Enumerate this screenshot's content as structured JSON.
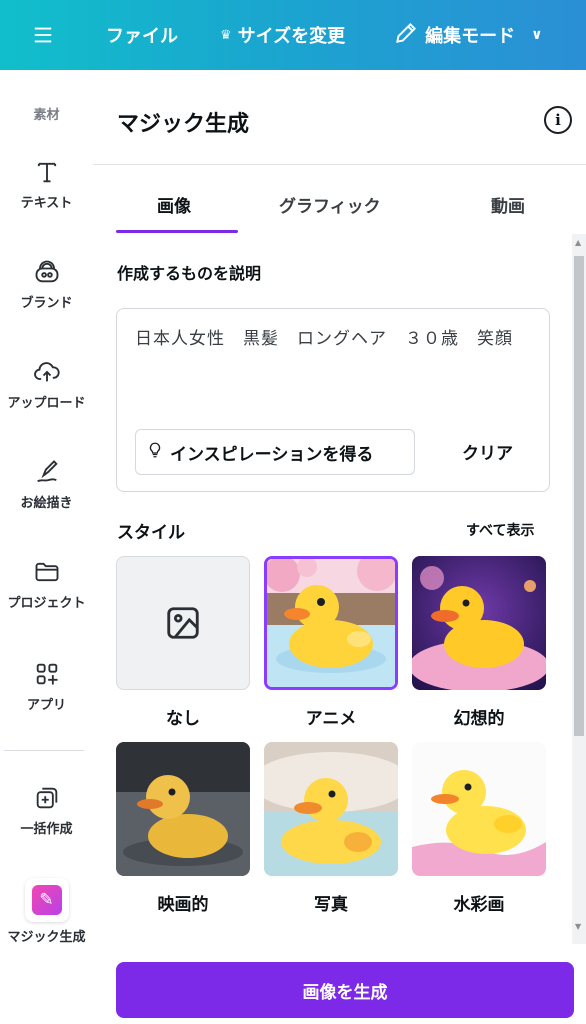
{
  "topbar": {
    "file": "ファイル",
    "resize": "サイズを変更",
    "edit_mode": "編集モード"
  },
  "sidebar": {
    "items": [
      {
        "label": "素材",
        "icon": "elements-icon"
      },
      {
        "label": "テキスト",
        "icon": "text-icon"
      },
      {
        "label": "ブランド",
        "icon": "brand-icon"
      },
      {
        "label": "アップロード",
        "icon": "upload-icon"
      },
      {
        "label": "お絵描き",
        "icon": "draw-icon"
      },
      {
        "label": "プロジェクト",
        "icon": "folder-icon"
      },
      {
        "label": "アプリ",
        "icon": "apps-icon"
      },
      {
        "label": "一括作成",
        "icon": "bulk-create-icon"
      },
      {
        "label": "マジック生成",
        "icon": "magic-generate-icon"
      }
    ]
  },
  "panel": {
    "title": "マジック生成",
    "tabs": [
      {
        "label": "画像",
        "active": true
      },
      {
        "label": "グラフィック",
        "active": false
      },
      {
        "label": "動画",
        "active": false
      }
    ],
    "describe_label": "作成するものを説明",
    "prompt": "日本人女性　黒髪　ロングヘア　３０歳　笑顔",
    "inspiration_button": "インスピレーションを得る",
    "clear_button": "クリア",
    "style_label": "スタイル",
    "show_all": "すべて表示",
    "styles": [
      {
        "label": "なし",
        "selected": false
      },
      {
        "label": "アニメ",
        "selected": true
      },
      {
        "label": "幻想的",
        "selected": false
      },
      {
        "label": "映画的",
        "selected": false
      },
      {
        "label": "写真",
        "selected": false
      },
      {
        "label": "水彩画",
        "selected": false
      }
    ],
    "generate_button": "画像を生成"
  },
  "colors": {
    "accent": "#7d2ae8",
    "topbar_start": "#11bfcb",
    "topbar_end": "#2b8fd6"
  }
}
